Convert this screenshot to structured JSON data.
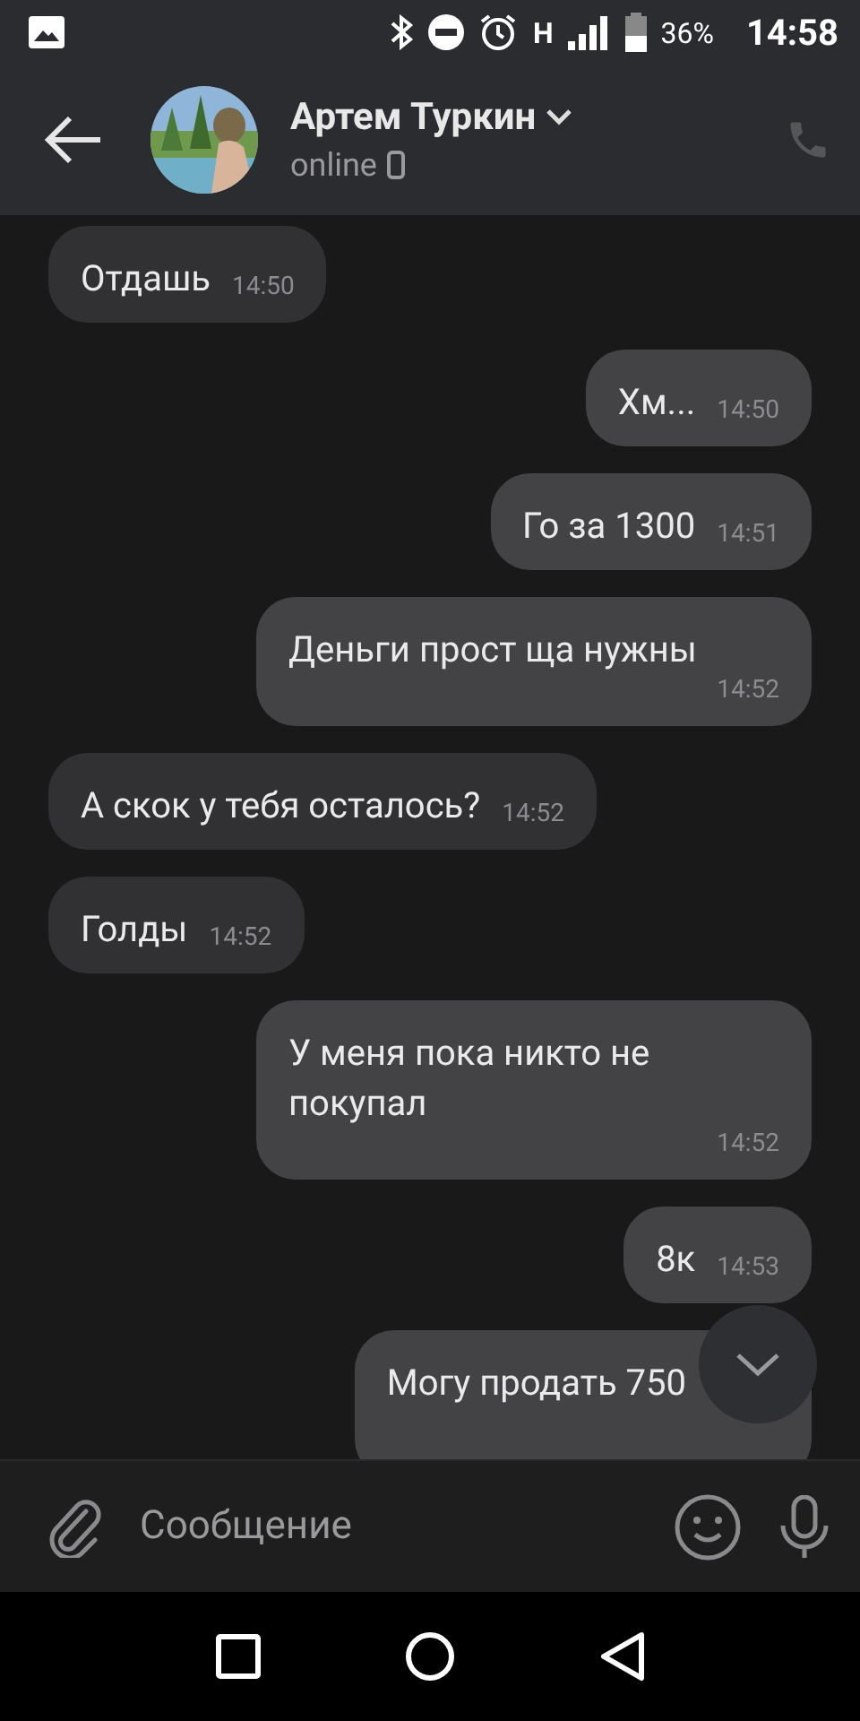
{
  "status_bar": {
    "network": "H",
    "battery": "36%",
    "time": "14:58"
  },
  "header": {
    "name": "Артем Туркин",
    "status": "online"
  },
  "messages": [
    {
      "kind": "in",
      "text": "Отдашь",
      "time": "14:50"
    },
    {
      "kind": "out",
      "text": "Хм...",
      "time": "14:50"
    },
    {
      "kind": "out",
      "text": "Го за 1300",
      "time": "14:51"
    },
    {
      "kind": "out",
      "text": "Деньги прост ща нужны",
      "time": "14:52"
    },
    {
      "kind": "in",
      "text": "А скок у тебя осталось?",
      "time": "14:52"
    },
    {
      "kind": "in",
      "text": "Голды",
      "time": "14:52"
    },
    {
      "kind": "out",
      "text": "У меня пока никто не покупал",
      "time": "14:52"
    },
    {
      "kind": "out",
      "text": "8к",
      "time": "14:53"
    },
    {
      "kind": "out",
      "text": "Могу продать 750"
    }
  ],
  "composer": {
    "placeholder": "Сообщение"
  }
}
